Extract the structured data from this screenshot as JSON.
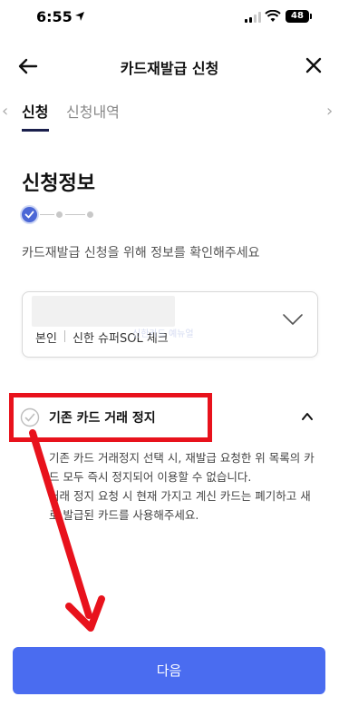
{
  "status_bar": {
    "time": "6:55",
    "battery": "48"
  },
  "header": {
    "title": "카드재발급 신청"
  },
  "tabs": [
    {
      "label": "신청",
      "active": true
    },
    {
      "label": "신청내역",
      "active": false
    }
  ],
  "section": {
    "title": "신청정보",
    "instruction": "카드재발급 신청을 위해 정보를 확인해주세요"
  },
  "card_select": {
    "owner_label": "본인",
    "card_name": "신한 슈퍼SOL 체크",
    "watermark": "신한카드 예뉴얼"
  },
  "stop_option": {
    "label": "기존 카드 거래 정지",
    "notice_1": "기존 카드 거래정지 선택 시, 재발급 요청한 위 목록의 카드 모두 즉시 정지되어 이용할 수 없습니다.",
    "notice_2": "거래 정지 요청 시 현재 가지고 계신 카드는 폐기하고 새로 발급된 카드를 사용해주세요."
  },
  "footer": {
    "next_label": "다음"
  },
  "colors": {
    "accent": "#4a6cf0",
    "annotation": "#e8121c",
    "step_active": "#4b67d6"
  }
}
